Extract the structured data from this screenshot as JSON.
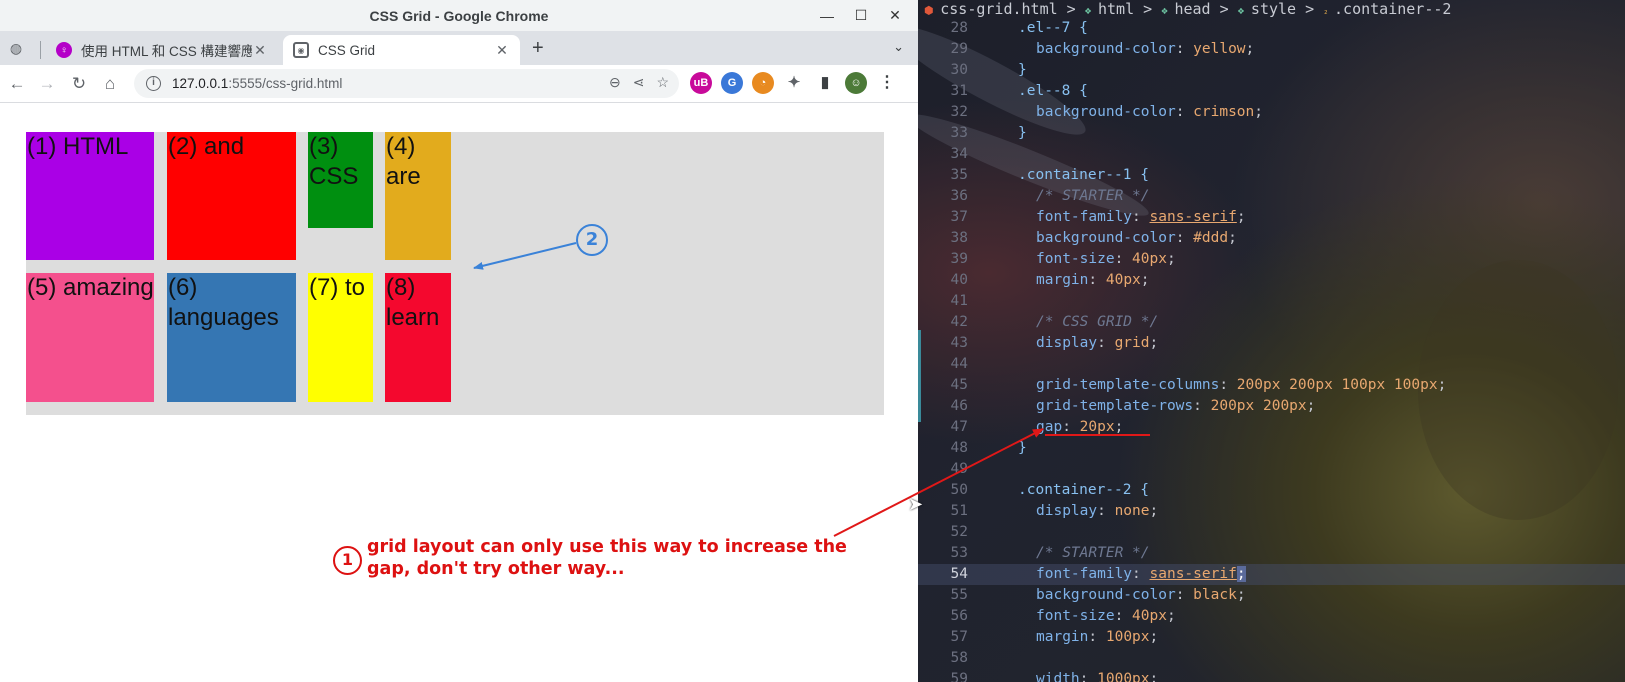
{
  "window": {
    "title": "CSS Grid - Google Chrome",
    "minimize": "—",
    "maximize": "☐",
    "close": "✕"
  },
  "tabs": [
    {
      "label": "使用 HTML 和 CSS 構建響應",
      "favicon": "♀",
      "close": "✕"
    },
    {
      "label": "CSS Grid",
      "favicon": "((•))",
      "close": "✕"
    }
  ],
  "tabstrip": {
    "new_tab": "+",
    "tab_search": "⌄",
    "ghost": "◍"
  },
  "toolbar": {
    "back": "←",
    "forward": "→",
    "reload": "↻",
    "home": "⌂",
    "info": "i",
    "url_host": "127.0.0.1",
    "url_rest": ":5555/css-grid.html",
    "zoom": "⊖",
    "share": "⋖",
    "bookmark": "☆",
    "menu": "⋮"
  },
  "extensions": [
    {
      "label": "uB",
      "color": "#c80a9a"
    },
    {
      "label": "G",
      "color": "#3a78d8"
    },
    {
      "label": "◔",
      "color": "#e88a20"
    },
    {
      "label": "✦",
      "color": "#5f6368"
    },
    {
      "label": "▮",
      "color": "#3c4043"
    },
    {
      "label": "☺",
      "color": "#4c7a38"
    }
  ],
  "grid_items": [
    {
      "text": "(1) HTML",
      "class": "el-1"
    },
    {
      "text": "(2) and",
      "class": "el-2"
    },
    {
      "text": "(3) CSS",
      "class": "el-3"
    },
    {
      "text": "(4) are",
      "class": "el-4"
    },
    {
      "text": "(5) amazing",
      "class": "el-5"
    },
    {
      "text": "(6) languages",
      "class": "el-6"
    },
    {
      "text": "(7) to",
      "class": "el-7"
    },
    {
      "text": "(8) learn",
      "class": "el-8"
    }
  ],
  "annotations": {
    "circle1": "1",
    "circle2": "2",
    "note": "grid layout can only use this way to increase the gap, don't try other way..."
  },
  "editor": {
    "breadcrumb": {
      "file": "css-grid.html",
      "parts": [
        "html",
        "head",
        "style"
      ],
      "selector": ".container--2"
    },
    "lines": [
      {
        "n": "28",
        "parts": [
          [
            "sel",
            ".el--7 {"
          ]
        ]
      },
      {
        "n": "29",
        "indent": 2,
        "parts": [
          [
            "prop",
            "background-color"
          ],
          [
            "punc",
            ": "
          ],
          [
            "val",
            "yellow"
          ],
          [
            "punc",
            ";"
          ]
        ]
      },
      {
        "n": "30",
        "parts": [
          [
            "sel",
            "}"
          ]
        ]
      },
      {
        "n": "31",
        "parts": [
          [
            "sel",
            ".el--8 {"
          ]
        ]
      },
      {
        "n": "32",
        "indent": 2,
        "parts": [
          [
            "prop",
            "background-color"
          ],
          [
            "punc",
            ": "
          ],
          [
            "val",
            "crimson"
          ],
          [
            "punc",
            ";"
          ]
        ]
      },
      {
        "n": "33",
        "parts": [
          [
            "sel",
            "}"
          ]
        ]
      },
      {
        "n": "34",
        "parts": []
      },
      {
        "n": "35",
        "parts": [
          [
            "sel",
            ".container--1 {"
          ]
        ]
      },
      {
        "n": "36",
        "indent": 2,
        "parts": [
          [
            "com",
            "/* STARTER */"
          ]
        ]
      },
      {
        "n": "37",
        "indent": 2,
        "parts": [
          [
            "prop",
            "font-family"
          ],
          [
            "punc",
            ": "
          ],
          [
            "font",
            "sans-serif"
          ],
          [
            "punc",
            ";"
          ]
        ]
      },
      {
        "n": "38",
        "indent": 2,
        "parts": [
          [
            "prop",
            "background-color"
          ],
          [
            "punc",
            ": "
          ],
          [
            "val",
            "#ddd"
          ],
          [
            "punc",
            ";"
          ]
        ]
      },
      {
        "n": "39",
        "indent": 2,
        "parts": [
          [
            "prop",
            "font-size"
          ],
          [
            "punc",
            ": "
          ],
          [
            "num",
            "40px"
          ],
          [
            "punc",
            ";"
          ]
        ]
      },
      {
        "n": "40",
        "indent": 2,
        "parts": [
          [
            "prop",
            "margin"
          ],
          [
            "punc",
            ": "
          ],
          [
            "num",
            "40px"
          ],
          [
            "punc",
            ";"
          ]
        ]
      },
      {
        "n": "41",
        "parts": []
      },
      {
        "n": "42",
        "indent": 2,
        "parts": [
          [
            "com",
            "/* CSS GRID */"
          ]
        ]
      },
      {
        "n": "43",
        "indent": 2,
        "parts": [
          [
            "prop",
            "display"
          ],
          [
            "punc",
            ": "
          ],
          [
            "val",
            "grid"
          ],
          [
            "punc",
            ";"
          ]
        ]
      },
      {
        "n": "44",
        "parts": []
      },
      {
        "n": "45",
        "indent": 2,
        "parts": [
          [
            "prop",
            "grid-template-columns"
          ],
          [
            "punc",
            ": "
          ],
          [
            "num",
            "200px 200px 100px 100px"
          ],
          [
            "punc",
            ";"
          ]
        ]
      },
      {
        "n": "46",
        "indent": 2,
        "parts": [
          [
            "prop",
            "grid-template-rows"
          ],
          [
            "punc",
            ": "
          ],
          [
            "num",
            "200px 200px"
          ],
          [
            "punc",
            ";"
          ]
        ]
      },
      {
        "n": "47",
        "indent": 2,
        "parts": [
          [
            "prop",
            "gap"
          ],
          [
            "punc",
            ": "
          ],
          [
            "num",
            "20px"
          ],
          [
            "punc",
            ";"
          ]
        ]
      },
      {
        "n": "48",
        "parts": [
          [
            "sel",
            "}"
          ]
        ]
      },
      {
        "n": "49",
        "parts": []
      },
      {
        "n": "50",
        "parts": [
          [
            "sel",
            ".container--2 {"
          ]
        ]
      },
      {
        "n": "51",
        "indent": 2,
        "parts": [
          [
            "prop",
            "display"
          ],
          [
            "punc",
            ": "
          ],
          [
            "val",
            "none"
          ],
          [
            "punc",
            ";"
          ]
        ]
      },
      {
        "n": "52",
        "parts": []
      },
      {
        "n": "53",
        "indent": 2,
        "parts": [
          [
            "com",
            "/* STARTER */"
          ]
        ]
      },
      {
        "n": "54",
        "indent": 2,
        "current": true,
        "parts": [
          [
            "prop",
            "font-family"
          ],
          [
            "punc",
            ": "
          ],
          [
            "font",
            "sans-serif"
          ],
          [
            "cursor",
            ";"
          ]
        ]
      },
      {
        "n": "55",
        "indent": 2,
        "parts": [
          [
            "prop",
            "background-color"
          ],
          [
            "punc",
            ": "
          ],
          [
            "val",
            "black"
          ],
          [
            "punc",
            ";"
          ]
        ]
      },
      {
        "n": "56",
        "indent": 2,
        "parts": [
          [
            "prop",
            "font-size"
          ],
          [
            "punc",
            ": "
          ],
          [
            "num",
            "40px"
          ],
          [
            "punc",
            ";"
          ]
        ]
      },
      {
        "n": "57",
        "indent": 2,
        "parts": [
          [
            "prop",
            "margin"
          ],
          [
            "punc",
            ": "
          ],
          [
            "num",
            "100px"
          ],
          [
            "punc",
            ";"
          ]
        ]
      },
      {
        "n": "58",
        "parts": []
      },
      {
        "n": "59",
        "indent": 2,
        "parts": [
          [
            "prop",
            "width"
          ],
          [
            "punc",
            ": "
          ],
          [
            "num",
            "1000px"
          ],
          [
            "punc",
            ";"
          ]
        ]
      }
    ]
  },
  "colors": {
    "annotation_red": "#dd1111",
    "annotation_blue": "#3a82d8"
  }
}
